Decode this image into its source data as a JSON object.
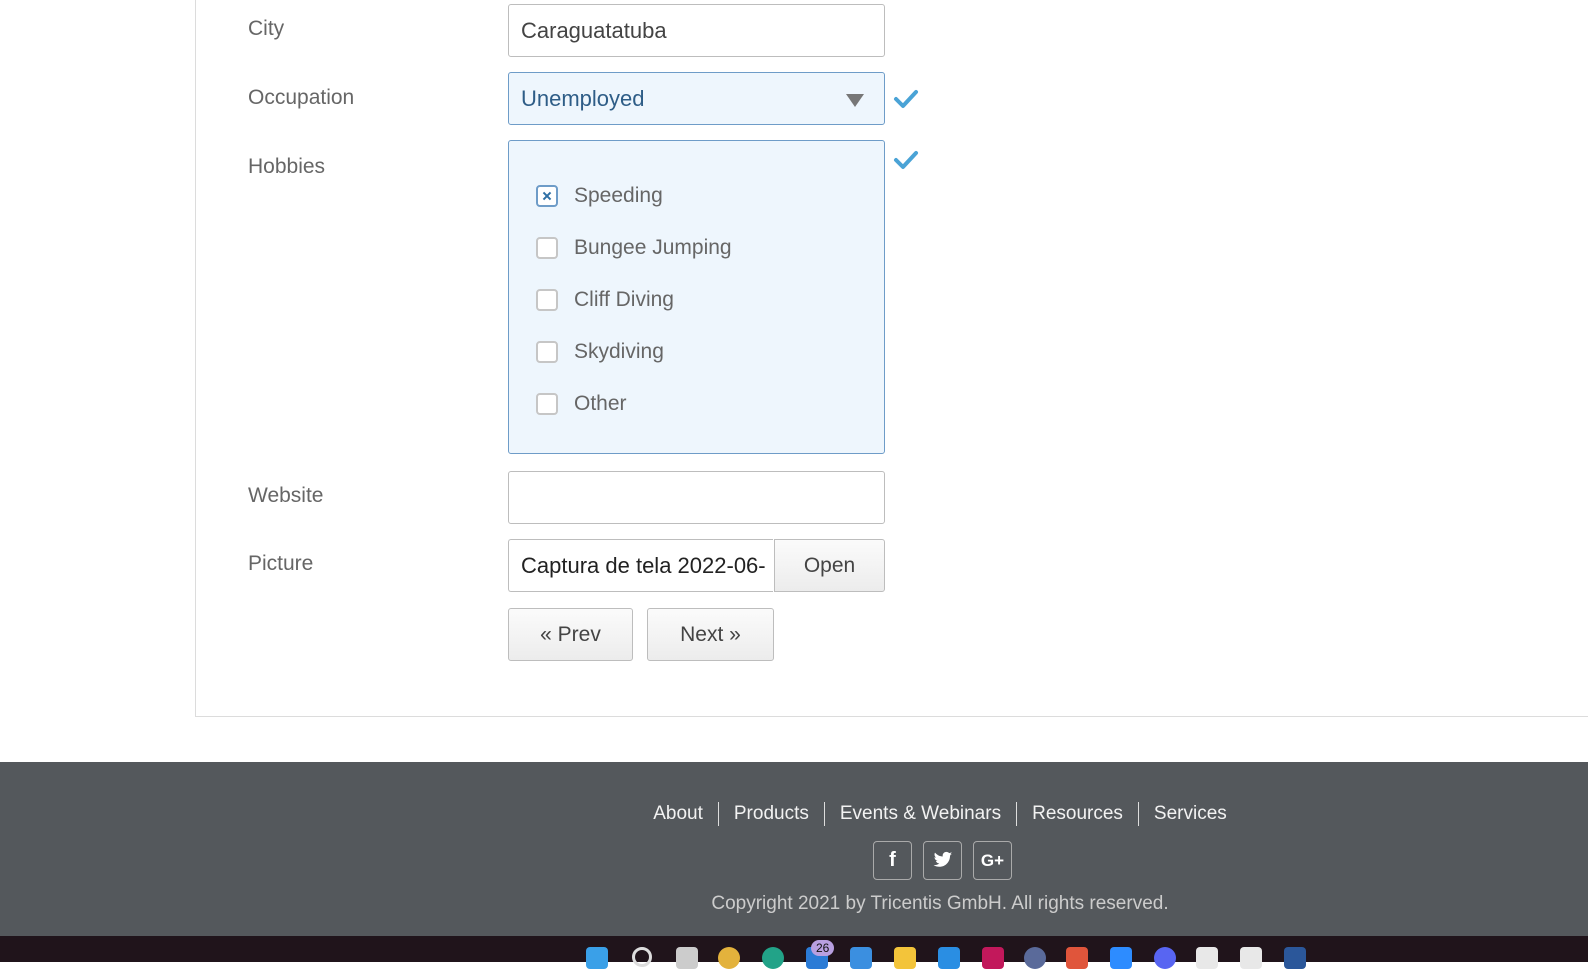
{
  "form": {
    "city_label": "City",
    "city_value": "Caraguatatuba",
    "occupation_label": "Occupation",
    "occupation_value": "Unemployed",
    "hobbies_label": "Hobbies",
    "hobbies": [
      {
        "label": "Speeding",
        "checked": true
      },
      {
        "label": "Bungee Jumping",
        "checked": false
      },
      {
        "label": "Cliff Diving",
        "checked": false
      },
      {
        "label": "Skydiving",
        "checked": false
      },
      {
        "label": "Other",
        "checked": false
      }
    ],
    "website_label": "Website",
    "website_value": "",
    "picture_label": "Picture",
    "picture_value": "Captura de tela 2022-06-",
    "open_button": "Open",
    "prev_button": "« Prev",
    "next_button": "Next »"
  },
  "footer": {
    "links": [
      "About",
      "Products",
      "Events & Webinars",
      "Resources",
      "Services"
    ],
    "social": [
      {
        "icon": "facebook-icon",
        "glyph": "f"
      },
      {
        "icon": "twitter-icon",
        "glyph": "t"
      },
      {
        "icon": "google-plus-icon",
        "glyph": "G+"
      }
    ],
    "copyright": "Copyright 2021 by Tricentis GmbH. All rights reserved."
  },
  "taskbar": {
    "mail_badge": "26"
  },
  "colors": {
    "accent": "#4aa3d6",
    "footer_bg": "#54585c",
    "select_bg": "#eef6fd"
  }
}
